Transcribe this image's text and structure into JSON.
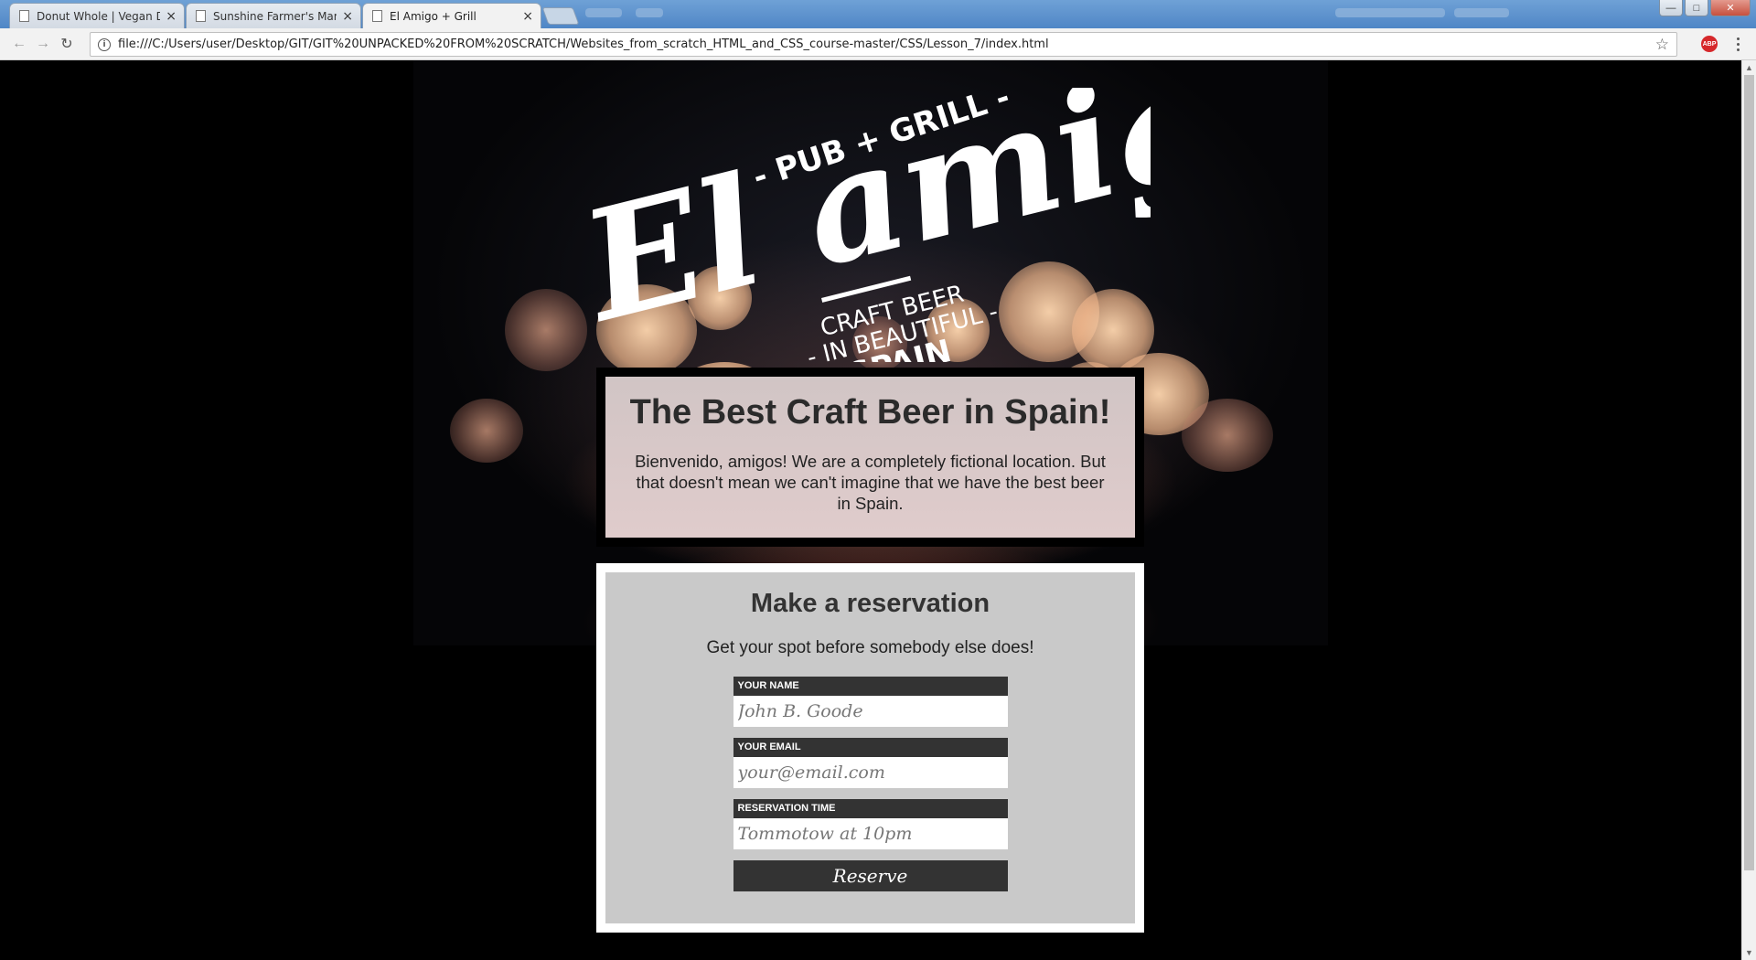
{
  "browser": {
    "tabs": [
      {
        "label": "Donut Whole | Vegan Do",
        "active": false
      },
      {
        "label": "Sunshine Farmer's Marke",
        "active": false
      },
      {
        "label": "El Amigo + Grill",
        "active": true
      }
    ],
    "tab_close_glyph": "×",
    "url": "file:///C:/Users/user/Desktop/GIT/GIT%20UNPACKED%20FROM%20SCRATCH/Websites_from_scratch_HTML_and_CSS_course-master/CSS/Lesson_7/index.html",
    "back_icon": "arrow-left-icon",
    "forward_icon": "arrow-right-icon",
    "reload_icon": "reload-icon",
    "bookmark_icon": "star-icon",
    "extension_label": "ABP",
    "window_controls": {
      "minimize": "—",
      "maximize": "□",
      "close": "✕"
    }
  },
  "logo": {
    "tagline_top": "- PUB + GRILL -",
    "name": "El amigo",
    "line1": "CRAFT BEER",
    "line2": "- IN BEAUTIFUL -",
    "line3": "SPAIN"
  },
  "intro": {
    "headline": "The Best Craft Beer in Spain!",
    "text": "Bienvenido, amigos! We are a completely fictional location. But that doesn't mean we can't imagine that we have the best beer in Spain."
  },
  "reservation": {
    "title": "Make a reservation",
    "subtitle": "Get your spot before somebody else does!",
    "fields": [
      {
        "label": "YOUR NAME",
        "placeholder": "John B. Goode",
        "value": ""
      },
      {
        "label": "YOUR EMAIL",
        "placeholder": "your@email.com",
        "value": ""
      },
      {
        "label": "RESERVATION TIME",
        "placeholder": "Tommotow at 10pm",
        "value": ""
      }
    ],
    "submit_label": "Reserve"
  },
  "colors": {
    "label_bg": "#333333",
    "form_bg": "#c9c9c9",
    "intro_bg": "#ffe9e9",
    "page_bg": "#000000"
  }
}
